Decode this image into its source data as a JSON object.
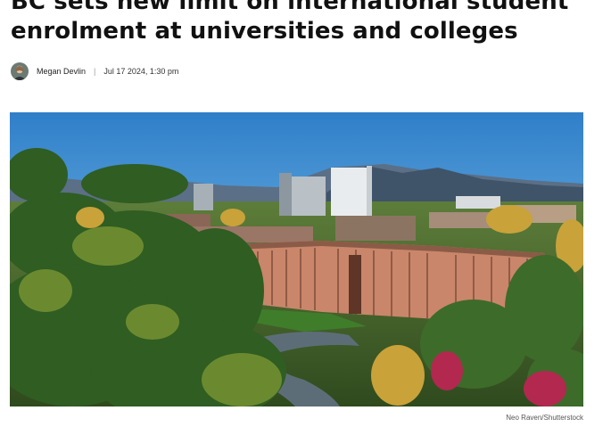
{
  "article": {
    "headline": "BC sets new limit on international student enrolment at universities and colleges",
    "author": "Megan Devlin",
    "separator": "|",
    "date": "Jul 17 2024, 1:30 pm",
    "image_credit": "Neo Raven/Shutterstock"
  },
  "icons": {
    "avatar": "author-avatar-photo"
  }
}
